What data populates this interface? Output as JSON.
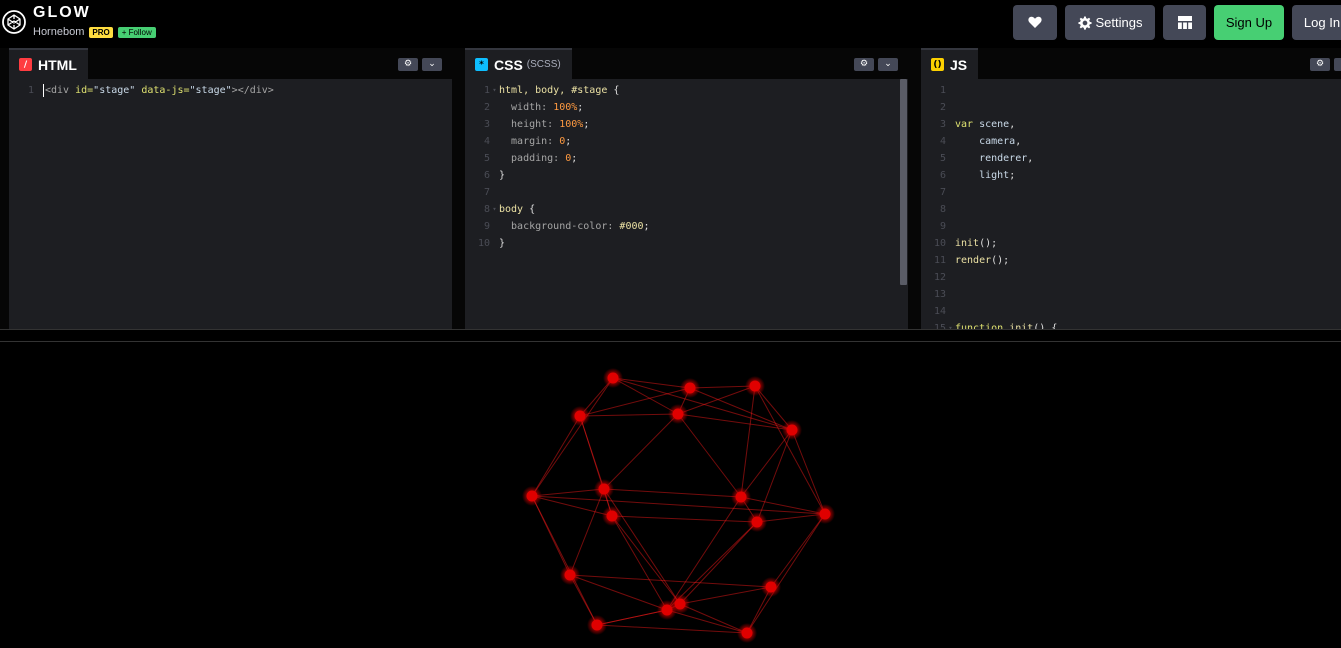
{
  "header": {
    "title": "GLOW",
    "author": "Hornebom",
    "pro_badge": "PRO",
    "follow_label": "+ Follow",
    "settings_label": "Settings",
    "signup_label": "Sign Up",
    "login_label": "Log In",
    "icons": {
      "logo": "codepen-logo-icon",
      "heart": "heart-icon",
      "settings": "gear-icon",
      "layout": "layout-grid-icon"
    }
  },
  "html_panel": {
    "title": "HTML",
    "icon": "html-slash-icon",
    "lines": [
      [
        [
          [
            "tag",
            "<div "
          ],
          [
            "attr",
            "id="
          ],
          [
            "str",
            "\"stage\" "
          ],
          [
            "attr",
            "data-js="
          ],
          [
            "str",
            "\"stage\""
          ],
          [
            "tag",
            "></div>"
          ]
        ]
      ]
    ]
  },
  "css_panel": {
    "title": "CSS",
    "preprocessor": "(SCSS)",
    "icon": "css-asterisk-icon",
    "lines": [
      [
        [
          [
            "sel",
            "html, body, #stage "
          ],
          [
            "punc",
            "{"
          ]
        ],
        true
      ],
      [
        [
          [
            "prop",
            "  width: "
          ],
          [
            "num",
            "100%"
          ],
          [
            "punc",
            ";"
          ]
        ]
      ],
      [
        [
          [
            "prop",
            "  height: "
          ],
          [
            "num",
            "100%"
          ],
          [
            "punc",
            ";"
          ]
        ]
      ],
      [
        [
          [
            "prop",
            "  margin: "
          ],
          [
            "num",
            "0"
          ],
          [
            "punc",
            ";"
          ]
        ]
      ],
      [
        [
          [
            "prop",
            "  padding: "
          ],
          [
            "num",
            "0"
          ],
          [
            "punc",
            ";"
          ]
        ]
      ],
      [
        [
          [
            "punc",
            "}"
          ]
        ]
      ],
      [
        []
      ],
      [
        [
          [
            "sel",
            "body "
          ],
          [
            "punc",
            "{"
          ]
        ],
        true
      ],
      [
        [
          [
            "prop",
            "  background-color: "
          ],
          [
            "hex",
            "#000"
          ],
          [
            "punc",
            ";"
          ]
        ]
      ],
      [
        [
          [
            "punc",
            "}"
          ]
        ]
      ]
    ]
  },
  "js_panel": {
    "title": "JS",
    "icon": "js-braces-icon",
    "lines": [
      [
        []
      ],
      [
        []
      ],
      [
        [
          [
            "kw",
            "var "
          ],
          [
            "var",
            "scene"
          ],
          [
            "punc",
            ","
          ]
        ]
      ],
      [
        [
          [
            "var",
            "    camera"
          ],
          [
            "punc",
            ","
          ]
        ]
      ],
      [
        [
          [
            "var",
            "    renderer"
          ],
          [
            "punc",
            ","
          ]
        ]
      ],
      [
        [
          [
            "var",
            "    light"
          ],
          [
            "punc",
            ";"
          ]
        ]
      ],
      [
        []
      ],
      [
        []
      ],
      [
        []
      ],
      [
        [
          [
            "fn",
            "init"
          ],
          [
            "punc",
            "();"
          ]
        ]
      ],
      [
        [
          [
            "fn",
            "render"
          ],
          [
            "punc",
            "();"
          ]
        ]
      ],
      [
        []
      ],
      [
        []
      ],
      [
        []
      ],
      [
        [
          [
            "kw",
            "function "
          ],
          [
            "fn",
            "init"
          ],
          [
            "punc",
            "() {"
          ]
        ],
        true
      ]
    ]
  },
  "colors": {
    "accent_green": "#47cf73",
    "pro_yellow": "#ffdd40",
    "html_icon": "#ff3c41",
    "css_icon": "#0ebeff",
    "js_icon": "#fcd000",
    "glow_red": "#ff1a1a"
  }
}
